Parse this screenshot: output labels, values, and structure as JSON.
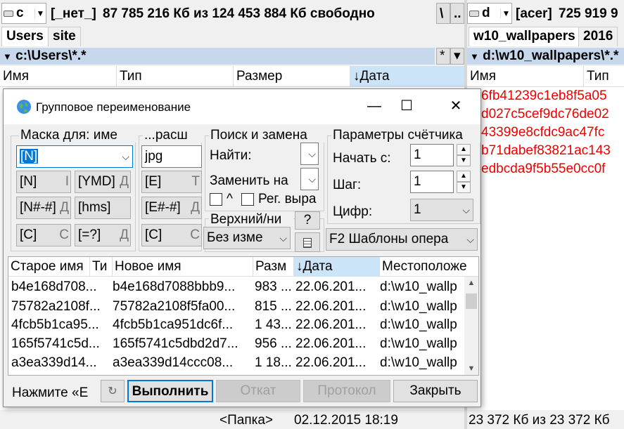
{
  "left_panel": {
    "drive": "c",
    "volume_label": "[_нет_]",
    "free_space": "87 785 216 Кб из 124 453 884 Кб свободно",
    "root_btn": "\\",
    "parent_btn": "..",
    "tabs": [
      "Users",
      "site"
    ],
    "path": "c:\\Users\\*.*",
    "path_btn": "*",
    "history_btn": "▾",
    "columns": [
      "Имя",
      "Тип",
      "Размер",
      "↓Дата"
    ],
    "status_item": "<Папка>",
    "status_date": "02.12.2015 18:19"
  },
  "right_panel": {
    "drive": "d",
    "volume_label": "[acer]",
    "free_space": "725 919 9",
    "tabs": [
      "w10_wallpapers",
      "2016"
    ],
    "path": "d:\\w10_wallpapers\\*.*",
    "columns": [
      "Имя",
      "Тип"
    ],
    "files": [
      "6fb41239c1eb8f5a05",
      "d027c5cef9dc76de02",
      "43399e8cfdc9ac47fc",
      "b71dabef83821ac143",
      "edbcda9f5b55e0cc0f"
    ],
    "status": "23 372 Кб из 23 372 Кб"
  },
  "dialog": {
    "title": "Групповое переименование",
    "window_buttons": {
      "minimize": "—",
      "maximize": "☐",
      "close": "✕"
    },
    "mask_group": {
      "label": "Маска для: име",
      "value": "[N]",
      "buttons": [
        "[N]",
        "[YMD]",
        "[N#-#]",
        "[hms]",
        "[C]",
        "[=?]"
      ],
      "button_suffixes": [
        "I",
        "Д",
        "Д",
        "",
        "С",
        "Д"
      ]
    },
    "ext_group": {
      "label": "...расш",
      "value": "jpg",
      "buttons": [
        "[E]",
        "[E#-#]",
        "[C]"
      ],
      "button_suffixes": [
        "Т",
        "Д",
        "С"
      ]
    },
    "search_group": {
      "label": "Поиск и замена",
      "find_label": "Найти:",
      "replace_label": "Заменить на",
      "caret_label": "^",
      "regex_label": "Рег. выра"
    },
    "case_group": {
      "label": "Верхний/ни",
      "value": "Без изме",
      "help_btn": "?"
    },
    "counter_group": {
      "label": "Параметры счётчика",
      "start_label": "Начать с:",
      "start_value": "1",
      "step_label": "Шаг:",
      "step_value": "1",
      "digits_label": "Цифр:",
      "digits_value": "1",
      "templates_value": "F2 Шаблоны опера"
    },
    "list": {
      "columns": [
        "Старое имя",
        "Ти",
        "Новое имя",
        "Разм",
        "↓Дата",
        "Местоположе"
      ],
      "rows": [
        {
          "old": "b4e168d708...",
          "new": "b4e168d7088bbb9...",
          "size": "983 ...",
          "date": "22.06.201...",
          "loc": "d:\\w10_wallp"
        },
        {
          "old": "75782a2108f...",
          "new": "75782a2108f5fa00...",
          "size": "815 ...",
          "date": "22.06.201...",
          "loc": "d:\\w10_wallp"
        },
        {
          "old": "4fcb5b1ca95...",
          "new": "4fcb5b1ca951dc6f...",
          "size": "1 43...",
          "date": "22.06.201...",
          "loc": "d:\\w10_wallp"
        },
        {
          "old": "165f5741c5d...",
          "new": "165f5741c5dbd2d7...",
          "size": "956 ...",
          "date": "22.06.201...",
          "loc": "d:\\w10_wallp"
        },
        {
          "old": "a3ea339d14...",
          "new": "a3ea339d14ccc08...",
          "size": "1 18...",
          "date": "22.06.201...",
          "loc": "d:\\w10_wallp"
        }
      ]
    },
    "footer": {
      "hint": "Нажмите «E",
      "execute": "Выполнить",
      "undo": "Откат",
      "log": "Протокол",
      "close": "Закрыть"
    }
  },
  "colors": {
    "accent": "#0078d7",
    "path_bar": "#c8d8ec",
    "hash_red": "#e00000"
  }
}
